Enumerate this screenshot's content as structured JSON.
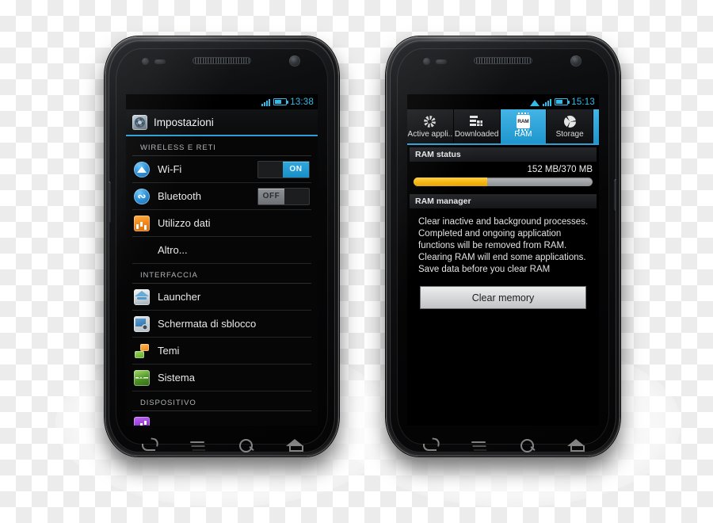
{
  "left_phone": {
    "status_bar": {
      "clock": "13:38",
      "signal_icon": "signal-bars-icon",
      "battery_icon": "battery-icon"
    },
    "app": {
      "title": "Impostazioni",
      "icon": "settings-gear-icon"
    },
    "sections": [
      {
        "header": "WIRELESS E RETI",
        "rows": [
          {
            "label": "Wi-Fi",
            "icon": "wifi-icon",
            "toggle": "ON",
            "toggle_state": "on"
          },
          {
            "label": "Bluetooth",
            "icon": "bluetooth-icon",
            "toggle": "OFF",
            "toggle_state": "off"
          },
          {
            "label": "Utilizzo dati",
            "icon": "data-usage-icon"
          },
          {
            "label": "Altro...",
            "icon": ""
          }
        ]
      },
      {
        "header": "INTERFACCIA",
        "rows": [
          {
            "label": "Launcher",
            "icon": "launcher-home-icon"
          },
          {
            "label": "Schermata di sblocco",
            "icon": "lockscreen-icon"
          },
          {
            "label": "Temi",
            "icon": "themes-icon"
          },
          {
            "label": "Sistema",
            "icon": "system-icon"
          }
        ]
      },
      {
        "header": "DISPOSITIVO",
        "rows": [
          {
            "label": "",
            "icon": "audio-icon"
          }
        ]
      }
    ],
    "nav": {
      "back": "back-icon",
      "menu": "menu-icon",
      "search": "search-icon",
      "home": "home-icon"
    }
  },
  "right_phone": {
    "status_bar": {
      "clock": "15:13",
      "wifi_icon": "wifi-icon",
      "signal_icon": "signal-bars-icon",
      "battery_icon": "battery-icon"
    },
    "tabs": [
      {
        "label": "Active appli..",
        "icon": "spinner-icon",
        "active": false
      },
      {
        "label": "Downloaded",
        "icon": "downloads-icon",
        "active": false
      },
      {
        "label": "RAM",
        "icon": "ram-chip-icon",
        "active": true
      },
      {
        "label": "Storage",
        "icon": "storage-disc-icon",
        "active": false
      }
    ],
    "ram_status": {
      "section_title": "RAM status",
      "amount": "152 MB/370 MB",
      "used_mb": 152,
      "total_mb": 370,
      "percent": 41,
      "fill_color": "#f5b50f",
      "track_color": "#8d9093"
    },
    "ram_manager": {
      "section_title": "RAM manager",
      "description": "Clear inactive and background processes. Completed and ongoing application functions will be removed from RAM. Clearing RAM will end some applications. Save data before you clear RAM",
      "button_label": "Clear memory"
    },
    "nav": {
      "back": "back-icon",
      "menu": "menu-icon",
      "search": "search-icon",
      "home": "home-icon"
    }
  },
  "theme": {
    "accent_blue": "#2d9fd4",
    "status_cyan": "#31bce9",
    "screen_black": "#060607"
  }
}
